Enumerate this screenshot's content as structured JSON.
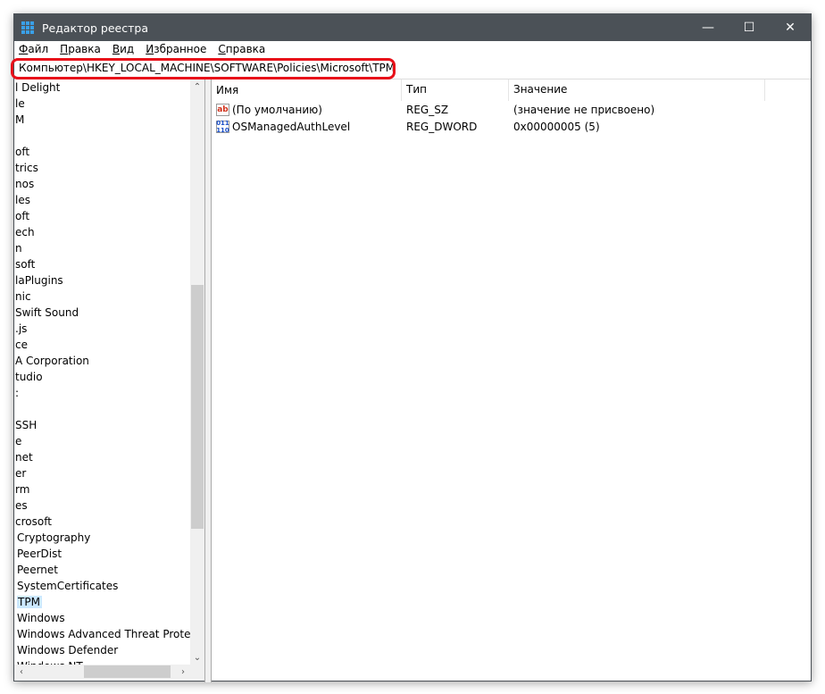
{
  "window": {
    "title": "Редактор реестра",
    "controls": [
      "—",
      "☐",
      "✕"
    ]
  },
  "menu": [
    "Файл",
    "Правка",
    "Вид",
    "Избранное",
    "Справка"
  ],
  "address": "Компьютер\\HKEY_LOCAL_MACHINE\\SOFTWARE\\Policies\\Microsoft\\TPM",
  "highlight_color": "#e8111a",
  "tree": {
    "items": [
      "l Delight",
      "le",
      "M",
      "",
      "oft",
      "trics",
      "nos",
      "les",
      "oft",
      "ech",
      "n",
      "soft",
      "laPlugins",
      "nic",
      "Swift Sound",
      ".js",
      "ce",
      "A Corporation",
      "tudio",
      ":",
      "",
      "SSH",
      "e",
      "net",
      "er",
      "rm",
      "es",
      "crosoft"
    ],
    "subitems": [
      "Cryptography",
      "PeerDist",
      "Peernet",
      "SystemCertificates",
      "TPM",
      "Windows",
      "Windows Advanced Threat Protectio",
      "Windows Defender",
      "Windows NT"
    ],
    "selected": "TPM"
  },
  "list": {
    "headers": [
      "Имя",
      "Тип",
      "Значение"
    ],
    "rows": [
      {
        "icon": "string-value-icon",
        "name": "(По умолчанию)",
        "type": "REG_SZ",
        "value": "(значение не присвоено)"
      },
      {
        "icon": "binary-value-icon",
        "name": "OSManagedAuthLevel",
        "type": "REG_DWORD",
        "value": "0x00000005 (5)"
      }
    ]
  }
}
